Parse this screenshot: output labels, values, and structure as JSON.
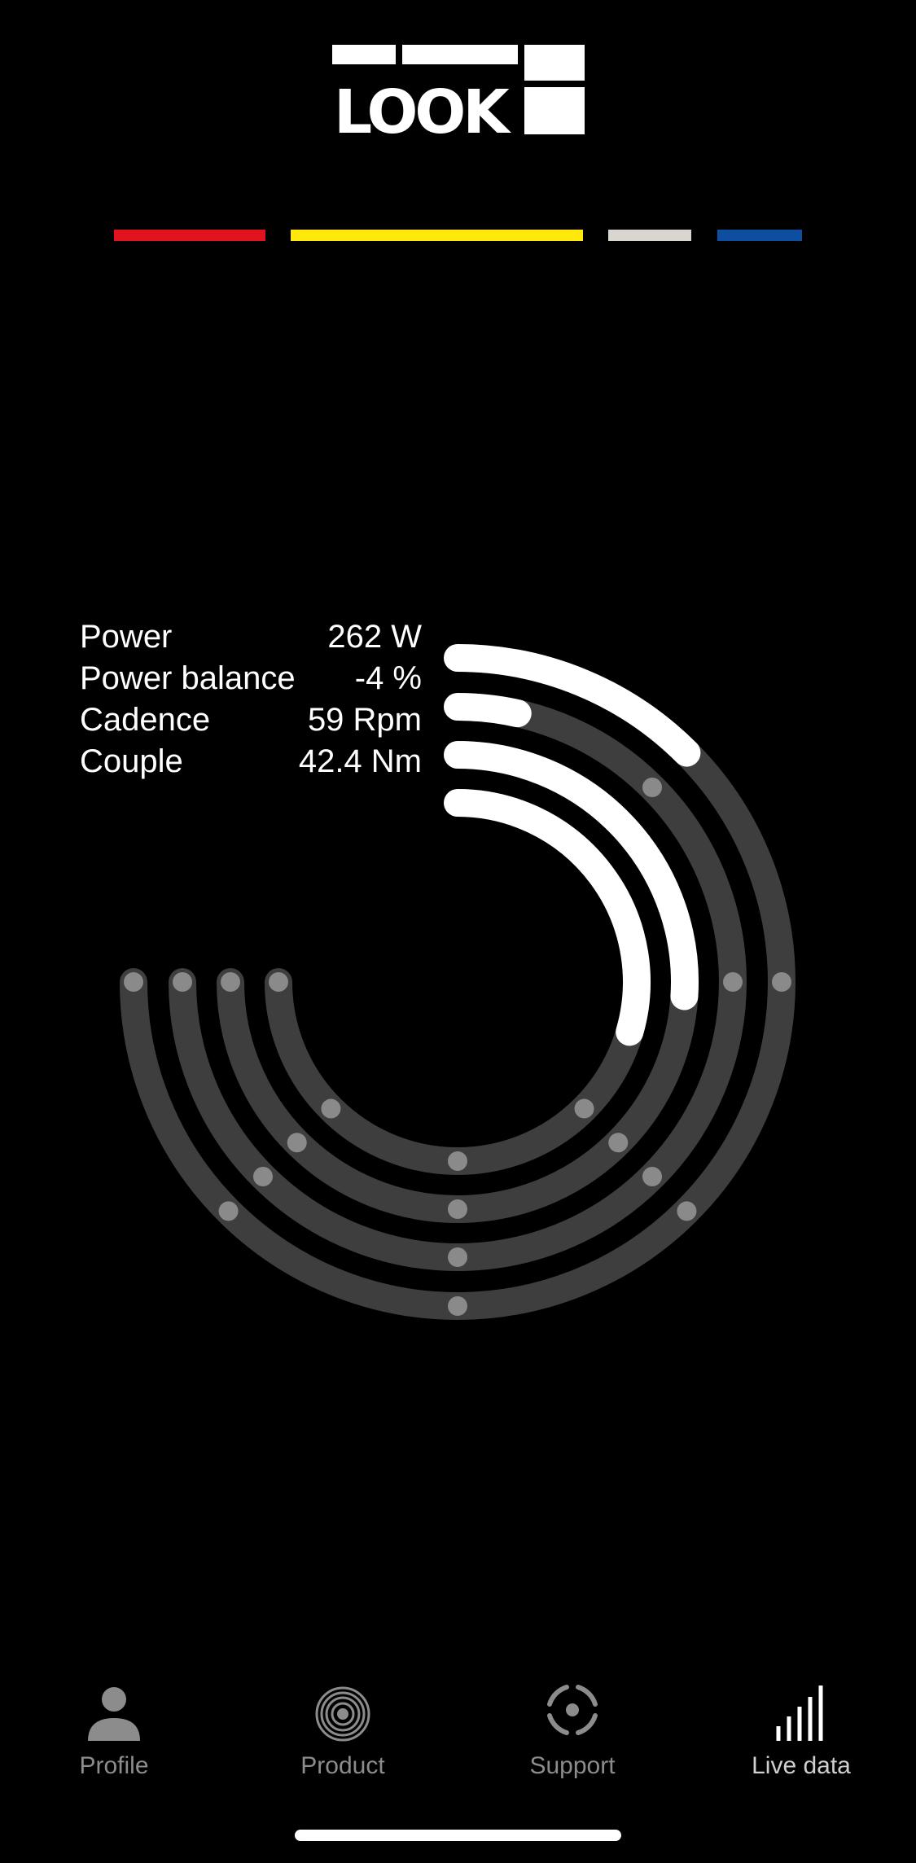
{
  "brand": {
    "name": "LOOK",
    "colors": [
      "#e2131e",
      "#ffe80a",
      "#d8d6cf",
      "#0d4ea1"
    ]
  },
  "metrics": [
    {
      "label": "Power",
      "value": "262 W"
    },
    {
      "label": "Power balance",
      "value": "-4 %"
    },
    {
      "label": "Cadence",
      "value": "59 Rpm"
    },
    {
      "label": "Couple",
      "value": "42.4 Nm"
    }
  ],
  "dial": {
    "track_color": "#3e3e3e",
    "fill_color": "#ffffff",
    "tick_color": "#8a8a8a",
    "rings": [
      {
        "metric": "Power",
        "fill_fraction": 0.125
      },
      {
        "metric": "Power balance",
        "fill_fraction": 0.035
      },
      {
        "metric": "Cadence",
        "fill_fraction": 0.26
      },
      {
        "metric": "Couple",
        "fill_fraction": 0.295
      }
    ]
  },
  "tabbar": {
    "tabs": [
      {
        "label": "Profile",
        "icon": "person-icon"
      },
      {
        "label": "Product",
        "icon": "pedal-disc-icon"
      },
      {
        "label": "Support",
        "icon": "target-icon"
      },
      {
        "label": "Live data",
        "icon": "signal-bars-icon"
      }
    ],
    "active": "Live data"
  }
}
